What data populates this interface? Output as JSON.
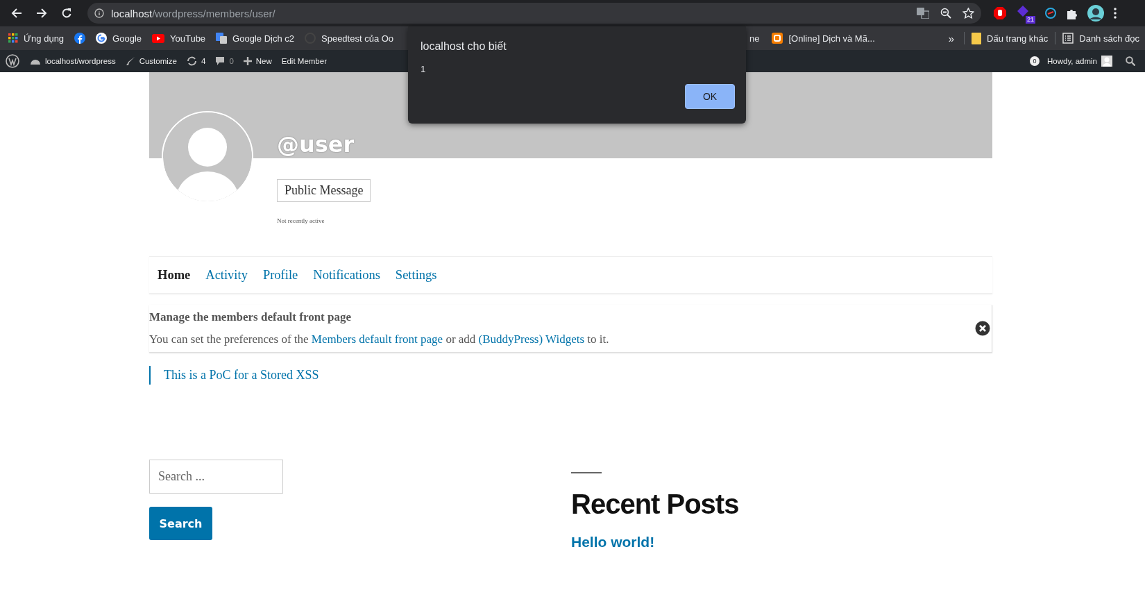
{
  "browser": {
    "url_host": "localhost",
    "url_path": "/wordpress/members/user/",
    "extension_badge": "21"
  },
  "bookmarks_left": [
    {
      "label": "Ứng dụng",
      "kind": "apps"
    },
    {
      "kind": "facebook"
    },
    {
      "label": "Google",
      "kind": "google"
    },
    {
      "label": "YouTube",
      "kind": "youtube"
    },
    {
      "label": "Google Dịch c2",
      "kind": "translate"
    },
    {
      "label": "Speedtest của Oo",
      "kind": "speedtest"
    }
  ],
  "bookmarks_right": [
    {
      "label": "ne",
      "kind": "plain"
    },
    {
      "label": "[Online] Dịch và Mã...",
      "kind": "blogger"
    }
  ],
  "bookmarks_more": "»",
  "bookmarks_other": [
    {
      "label": "Dấu trang khác",
      "kind": "folder"
    },
    {
      "label": "Danh sách đọc",
      "kind": "reading"
    }
  ],
  "admin_bar": {
    "site": "localhost/wordpress",
    "customize": "Customize",
    "updates": "4",
    "comments": "0",
    "new": "New",
    "edit": "Edit Member",
    "notifications": "0",
    "howdy": "Howdy, admin"
  },
  "alert": {
    "title": "localhost cho biết",
    "message": "1",
    "ok": "OK"
  },
  "profile": {
    "handle": "@user",
    "button": "Public Message",
    "activity": "Not recently active"
  },
  "tabs": [
    {
      "label": "Home",
      "selected": true
    },
    {
      "label": "Activity",
      "selected": false
    },
    {
      "label": "Profile",
      "selected": false
    },
    {
      "label": "Notifications",
      "selected": false
    },
    {
      "label": "Settings",
      "selected": false
    }
  ],
  "notice": {
    "title": "Manage the members default front page",
    "parts": [
      {
        "kind": "text",
        "text": "You can set the preferences of the "
      },
      {
        "kind": "link",
        "text": "Members default front page"
      },
      {
        "kind": "text",
        "text": " or add "
      },
      {
        "kind": "link",
        "text": "(BuddyPress) Widgets"
      },
      {
        "kind": "text",
        "text": " to it."
      }
    ]
  },
  "quote": "This is a PoC for a Stored XSS",
  "search": {
    "placeholder": "Search ...",
    "button": "Search"
  },
  "recent_posts": {
    "title": "Recent Posts",
    "items": [
      "Hello world!"
    ]
  }
}
